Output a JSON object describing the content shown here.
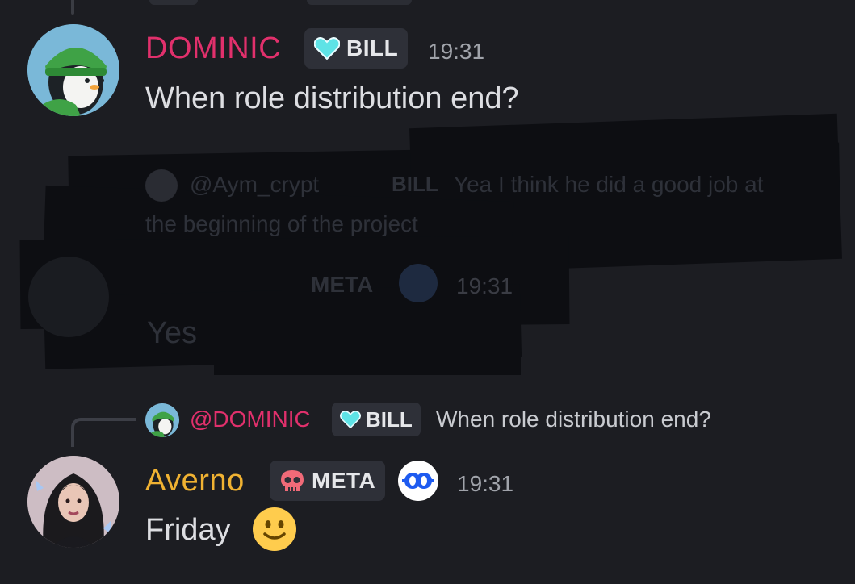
{
  "message1": {
    "author": "DOMINIC",
    "author_color": "#e1306c",
    "role": "BILL",
    "role_icon": "heart-icon",
    "time": "19:31",
    "text": "When role distribution end?"
  },
  "redacted": {
    "reply_name": "@Aym_crypt",
    "reply_role": "BILL",
    "reply_text_1": "Yea I think he did a good job at",
    "reply_text_2": "the beginning of the project",
    "role": "META",
    "time": "19:31",
    "text": "Yes"
  },
  "reply": {
    "name": "@DOMINIC",
    "role": "BILL",
    "text": "When role distribution end?"
  },
  "message2": {
    "author": "Averno",
    "author_color": "#f0b232",
    "role": "META",
    "role_icon": "skull-icon",
    "app_icon": "infinity-eyes-icon",
    "time": "19:31",
    "text": "Friday",
    "emoji": "slightly-smiling-face"
  }
}
